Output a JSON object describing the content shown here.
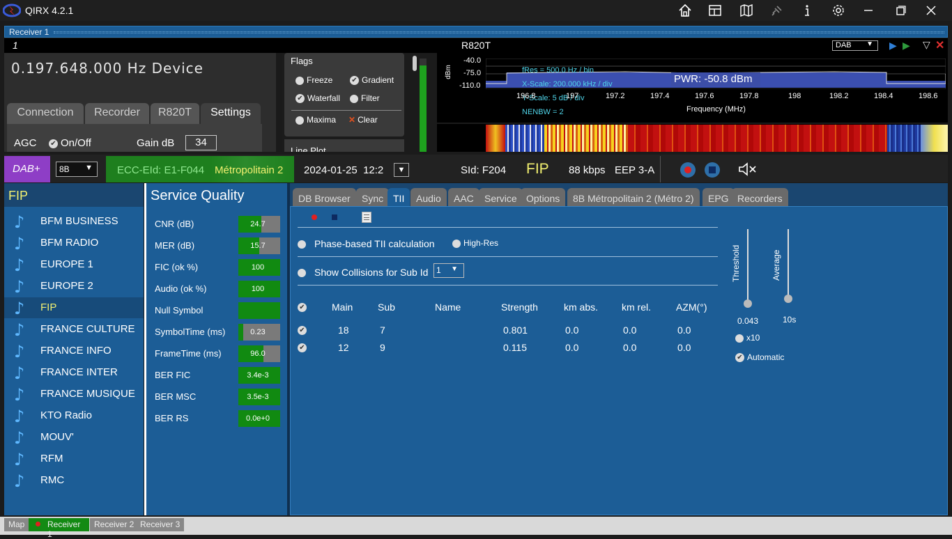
{
  "app": {
    "title": "QIRX 4.2.1"
  },
  "receiver": {
    "label": "Receiver 1",
    "number": "1",
    "device": "R820T",
    "mode": "DAB"
  },
  "frequency": {
    "display": "0.197.648.000 Hz Device"
  },
  "settings_tabs": [
    "Connection",
    "Recorder",
    "R820T",
    "Settings"
  ],
  "agc": {
    "label": "AGC",
    "onoff": "On/Off",
    "gain_label": "Gain dB",
    "gain_value": "34"
  },
  "flags": {
    "title": "Flags",
    "freeze": "Freeze",
    "gradient": "Gradient",
    "waterfall": "Waterfall",
    "filter": "Filter",
    "maxima": "Maxima",
    "clear": "Clear",
    "lineplot": "Line Plot"
  },
  "spectrum": {
    "ylabel": "dBm",
    "yticks": [
      "-40.0",
      "-75.0",
      "-110.0"
    ],
    "xticks": [
      "196.8",
      "197",
      "197.2",
      "197.4",
      "197.6",
      "197.8",
      "198",
      "198.2",
      "198.4",
      "198.6"
    ],
    "xlabel": "Frequency (MHz)",
    "info1": "fRes = 500.0 Hz / bin",
    "info2": "X-Scale: 200.000 kHz / div",
    "info3": "Y-Scale: 5 dB / div",
    "info4": "NENBW = 2",
    "power": "PWR: -50.8 dBm"
  },
  "dab": {
    "mode": "DAB+",
    "channel": "8B",
    "ensemble_id": "ECC-EId: E1-F044",
    "ensemble_name": "Métropolitain 2",
    "date": "2024-01-25  12:2",
    "sid": "SId: F204",
    "service": "FIP",
    "bitrate": "88 kbps",
    "eep": "EEP 3-A"
  },
  "services": {
    "header": "FIP",
    "items": [
      "BFM BUSINESS",
      "BFM RADIO",
      "EUROPE 1",
      "EUROPE 2",
      "FIP",
      "FRANCE CULTURE",
      "FRANCE INFO",
      "FRANCE INTER",
      "FRANCE MUSIQUE",
      "KTO Radio",
      "MOUV'",
      "RFM",
      "RMC"
    ],
    "selected": "FIP"
  },
  "quality": {
    "title": "Service Quality",
    "rows": [
      {
        "label": "CNR (dB)",
        "value": "24.7",
        "fill": 0.55
      },
      {
        "label": "MER (dB)",
        "value": "15.7",
        "fill": 0.5
      },
      {
        "label": "FIC (ok %)",
        "value": "100",
        "fill": 1.0
      },
      {
        "label": "Audio (ok %)",
        "value": "100",
        "fill": 1.0
      },
      {
        "label": "Null Symbol",
        "value": "",
        "fill": 1.0
      },
      {
        "label": "SymbolTime (ms)",
        "value": "0.23",
        "fill": 0.12
      },
      {
        "label": "FrameTime (ms)",
        "value": "96.0",
        "fill": 0.6
      },
      {
        "label": "BER FIC",
        "value": "3.4e-3",
        "fill": 1.0
      },
      {
        "label": "BER MSC",
        "value": "3.5e-3",
        "fill": 1.0
      },
      {
        "label": "BER RS",
        "value": "0.0e+0",
        "fill": 1.0
      }
    ]
  },
  "tabs": [
    "DB Browser",
    "Sync",
    "TII",
    "Audio",
    "AAC",
    "Service",
    "Options",
    "8B Métropolitain 2 (Métro 2)",
    "EPG",
    "Recorders"
  ],
  "tii": {
    "phase_label": "Phase-based TII calculation",
    "highres_label": "High-Res",
    "collisions_label": "Show Collisions for Sub Id",
    "collisions_value": "1",
    "columns": [
      "Main",
      "Sub",
      "Name",
      "Strength",
      "km abs.",
      "km rel.",
      "AZM(°)"
    ],
    "rows": [
      {
        "main": "18",
        "sub": "7",
        "name": "",
        "strength": "0.801",
        "kmabs": "0.0",
        "kmrel": "0.0",
        "azm": "0.0"
      },
      {
        "main": "12",
        "sub": "9",
        "name": "",
        "strength": "0.115",
        "kmabs": "0.0",
        "kmrel": "0.0",
        "azm": "0.0"
      }
    ],
    "threshold_label": "Threshold",
    "threshold_value": "0.043",
    "average_label": "Average",
    "average_value": "10s",
    "x10_label": "x10",
    "automatic_label": "Automatic"
  },
  "bottom_tabs": [
    "Map",
    "Receiver 1",
    "Receiver 2",
    "Receiver 3"
  ]
}
